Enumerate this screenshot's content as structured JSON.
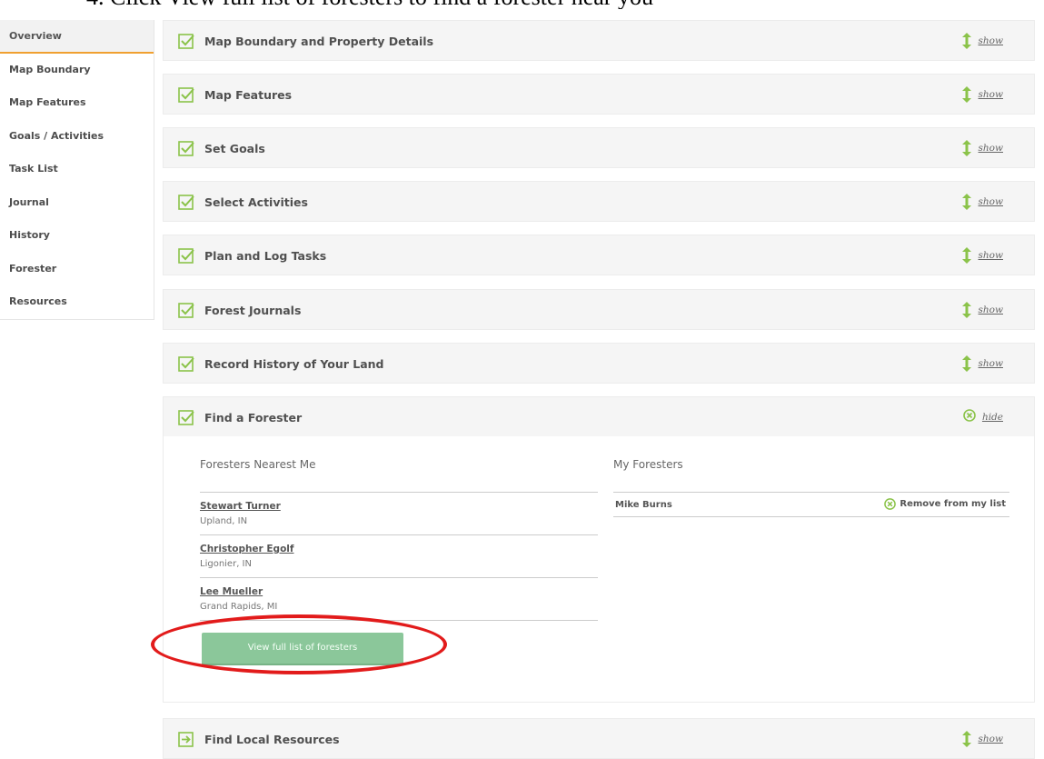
{
  "heading": "4.  Click View full list of foresters to find a forester near you",
  "sidebar": {
    "items": [
      {
        "label": "Overview",
        "active": true
      },
      {
        "label": "Map Boundary"
      },
      {
        "label": "Map Features"
      },
      {
        "label": "Goals / Activities"
      },
      {
        "label": "Task List"
      },
      {
        "label": "Journal"
      },
      {
        "label": "History"
      },
      {
        "label": "Forester"
      },
      {
        "label": "Resources"
      }
    ]
  },
  "sections": [
    {
      "title": "Map Boundary and Property Details",
      "toggle": "show"
    },
    {
      "title": "Map Features",
      "toggle": "show"
    },
    {
      "title": "Set Goals",
      "toggle": "show"
    },
    {
      "title": "Select Activities",
      "toggle": "show"
    },
    {
      "title": "Plan and Log Tasks",
      "toggle": "show"
    },
    {
      "title": "Forest Journals",
      "toggle": "show"
    },
    {
      "title": "Record History of Your Land",
      "toggle": "show"
    },
    {
      "title": "Find a Forester",
      "toggle": "hide"
    },
    {
      "title": "Find Local Resources",
      "toggle": "show"
    }
  ],
  "find_forester": {
    "nearest_heading": "Foresters Nearest Me",
    "my_heading": "My Foresters",
    "foresters": [
      {
        "name": "Stewart Turner",
        "location": "Upland, IN"
      },
      {
        "name": "Christopher Egolf",
        "location": "Ligonier, IN"
      },
      {
        "name": "Lee Mueller",
        "location": "Grand Rapids, MI"
      }
    ],
    "my_foresters": [
      {
        "name": "Mike Burns",
        "action": "Remove from my list"
      }
    ],
    "view_button": "View full list of foresters"
  },
  "colors": {
    "accent_green": "#8bc34a",
    "check_green": "#7cc576",
    "active_tab_underline": "#f0a030",
    "button_green": "#8bc79a",
    "highlight_red": "#e21b1b"
  },
  "icons": {
    "section_done": "checkbox-checked-icon",
    "section_forward": "arrow-right-box-icon",
    "expand": "vertical-arrow-icon",
    "collapse": "circle-x-icon"
  }
}
